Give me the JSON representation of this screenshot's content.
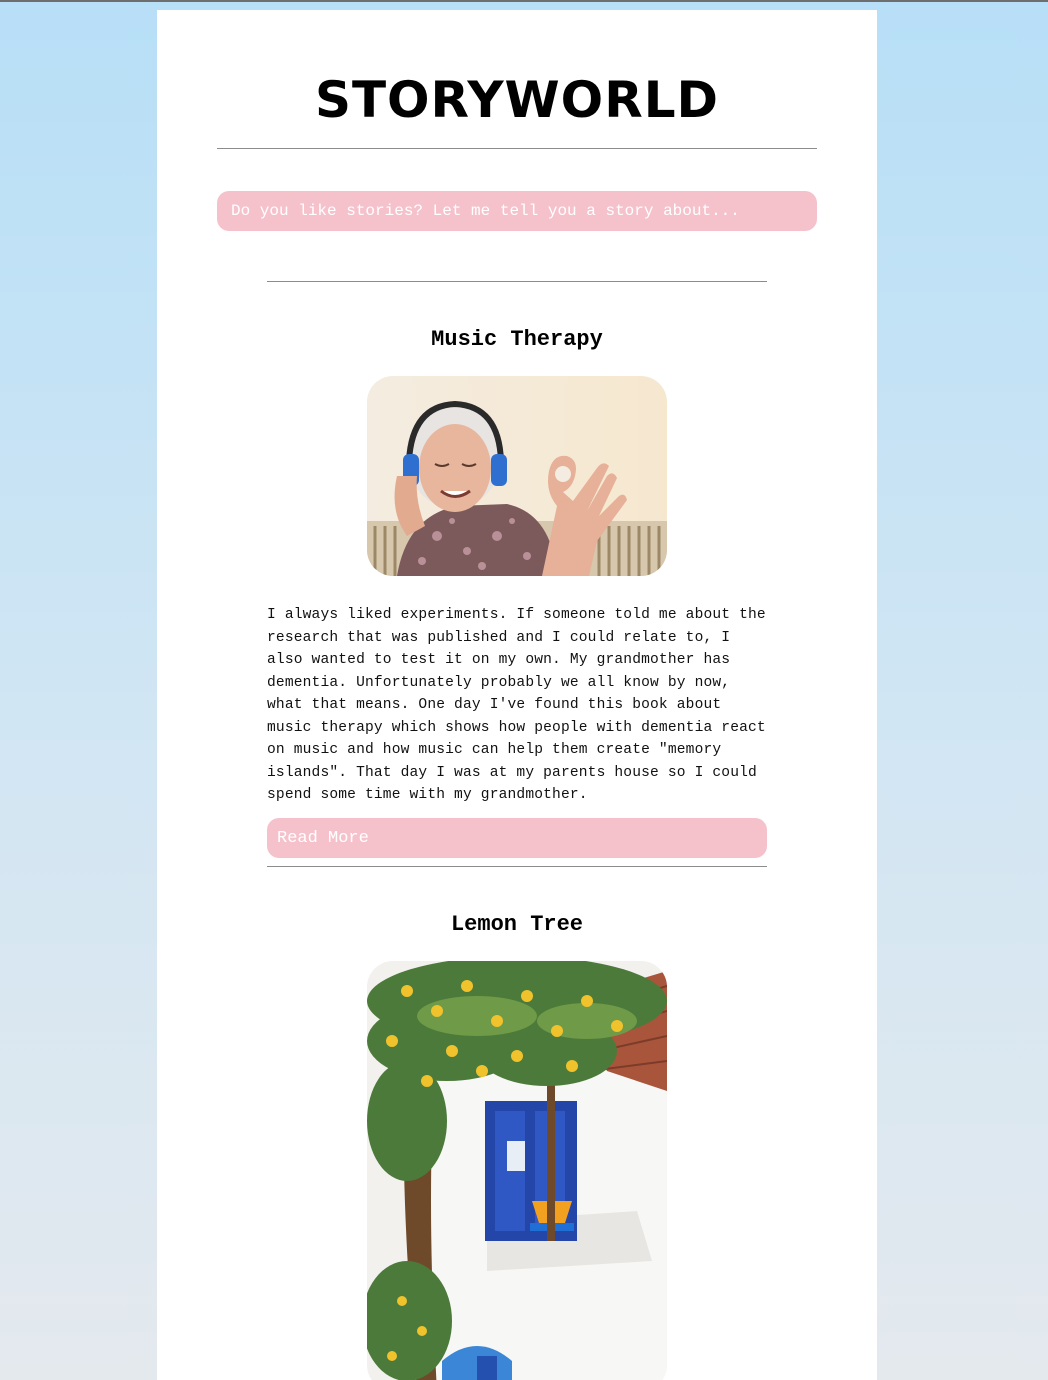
{
  "site": {
    "title": "STORYWORLD",
    "search_placeholder": "Do you like stories? Let me tell you a story about..."
  },
  "stories": [
    {
      "title": "Music Therapy",
      "image_alt": "Elderly woman with headphones making an OK gesture",
      "text": "I always liked experiments. If someone told me about the research that was published and I could relate to, I also wanted to test it on my own. My grandmother has dementia. Unfortunately probably we all know by now, what that means. One day I've found this book about music therapy which shows how people with dementia react on music and how music can help them create \"memory islands\". That day I was at my parents house so I could spend some time with my grandmother.",
      "read_more_label": "Read More"
    },
    {
      "title": "Lemon Tree",
      "image_alt": "Painting of a lemon tree by a white house with a blue door"
    }
  ],
  "colors": {
    "accent_pink": "#f5c2cc",
    "background_top": "#b7dff7",
    "background_bottom": "#e4e9ee"
  }
}
